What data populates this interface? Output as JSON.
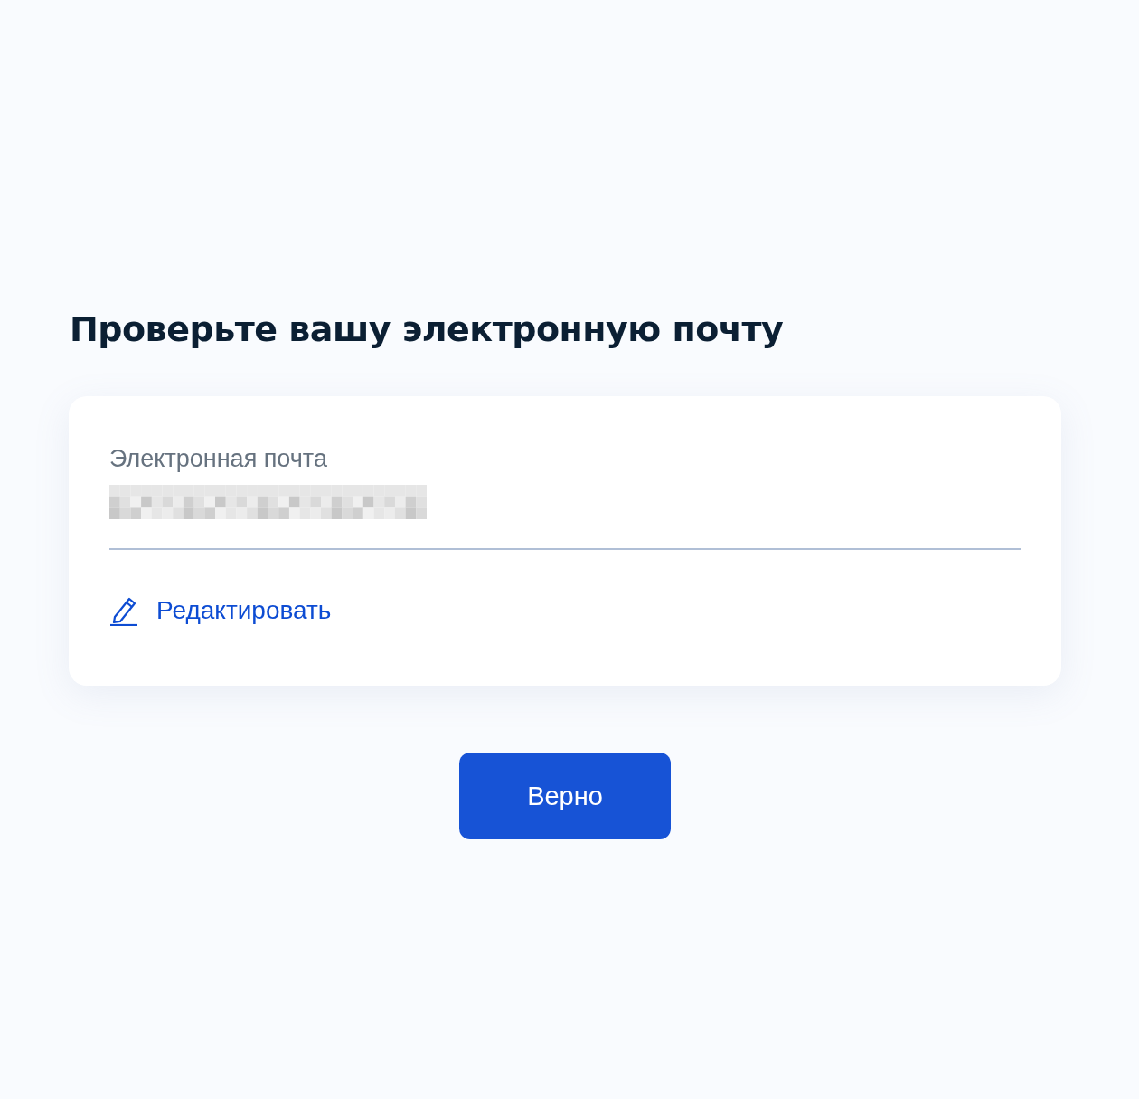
{
  "title": "Проверьте вашу электронную почту",
  "field": {
    "label": "Электронная почта"
  },
  "edit_link": "Редактировать",
  "buttons": [
    {
      "label": "Верно",
      "kind": "primary"
    }
  ]
}
